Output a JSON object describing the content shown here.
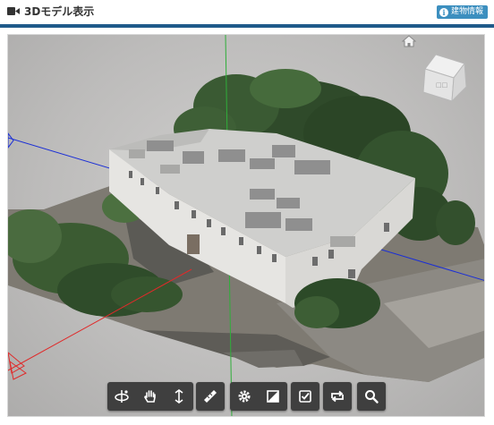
{
  "header": {
    "title": "3Dモデル表示",
    "info_badge": "建物情報",
    "rule_color": "#1f5a8a",
    "badge_color": "#3c8fbf"
  },
  "viewer": {
    "axis_colors": {
      "x": "#1a2ed6",
      "y": "#2fae3a",
      "z": "#e02a2a"
    },
    "home_icon": "home-icon",
    "view_cube": "view-cube"
  },
  "toolbar": {
    "navigation": [
      "orbit-icon",
      "pan-hand-icon",
      "zoom-vertical-icon"
    ],
    "measure": [
      "ruler-icon"
    ],
    "settings": [
      "gear-icon",
      "contrast-icon"
    ],
    "select": [
      "checkbox-icon"
    ],
    "view": [
      "reset-view-icon"
    ],
    "search": [
      "search-icon"
    ]
  }
}
